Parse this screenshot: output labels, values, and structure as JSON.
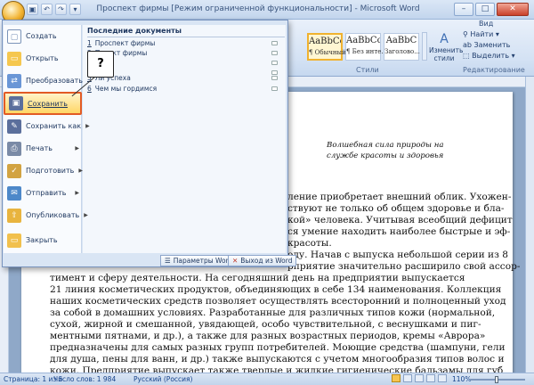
{
  "titlebar": {
    "title": "Проспект фирмы [Режим ограниченной функциональности] - Microsoft Word",
    "minimize": "–",
    "maximize": "□",
    "close": "✕"
  },
  "qat": [
    "save",
    "undo",
    "redo",
    "more"
  ],
  "ribbon": {
    "tabs": [
      "Вид"
    ],
    "styles": [
      {
        "preview": "AaBbCcI",
        "name": "¶ Обычный"
      },
      {
        "preview": "AaBbCcI",
        "name": "¶ Без инте..."
      },
      {
        "preview": "AaBbC",
        "name": "Заголово..."
      }
    ],
    "change_styles": "Изменить стили",
    "group_styles": "Стили",
    "group_editing": "Редактирование",
    "edit_find": "Найти",
    "edit_replace": "Заменить",
    "edit_select": "Выделить"
  },
  "office_menu": {
    "items": [
      {
        "label": "Создать",
        "icon": "new-document-icon",
        "submenu": false
      },
      {
        "label": "Открыть",
        "icon": "open-folder-icon",
        "submenu": false
      },
      {
        "label": "Преобразовать",
        "icon": "convert-icon",
        "submenu": false
      },
      {
        "label": "Сохранить",
        "icon": "save-icon",
        "submenu": false
      },
      {
        "label": "Сохранить как",
        "icon": "save-as-icon",
        "submenu": true
      },
      {
        "label": "Печать",
        "icon": "print-icon",
        "submenu": true
      },
      {
        "label": "Подготовить",
        "icon": "prepare-icon",
        "submenu": true
      },
      {
        "label": "Отправить",
        "icon": "send-icon",
        "submenu": true
      },
      {
        "label": "Опубликовать",
        "icon": "publish-icon",
        "submenu": true
      },
      {
        "label": "Закрыть",
        "icon": "close-document-icon",
        "submenu": false
      }
    ],
    "recent_header": "Последние документы",
    "recent": [
      {
        "num": "1",
        "name": "Проспект фирмы"
      },
      {
        "num": "2",
        "name": "Проект фирмы"
      },
      {
        "num": "3",
        "name": ""
      },
      {
        "num": "4",
        "name": ""
      },
      {
        "num": "5",
        "name": "Ли успеха"
      },
      {
        "num": "6",
        "name": "Чем мы гордимся"
      }
    ],
    "word_options": "Параметры Word",
    "exit_word": "Выход из Word",
    "callout": "?"
  },
  "document": {
    "heading_line1": "Волшебная сила природы на",
    "heading_line2": "службе красоты и здоровья",
    "lines": [
      "ление приобретает внешний облик. Ухожен-",
      "ствуют не только об общем здоровье и бла-",
      "кой» человека. Учитывая всеобщий дефицит",
      "ся умение находить наиболее быстрые и эф-",
      "красоты.",
      "оду. Начав с выпуска небольшой серии из 8",
      "рприятие значительно расширило свой ассор-",
      "тимент и сферу деятельности. На сегодняшний день на предприятии выпускается",
      "21 линия косметических продуктов, объединяющих в себе 134 наименования. Коллекция",
      "наших косметических средств позволяет осуществлять всесторонний и полноценный уход",
      "за собой в домашних условиях. Разработанные для различных типов кожи (нормальной,",
      "сухой, жирной и смешанной, увядающей, особо чувствительной, с веснушками и пиг-",
      "ментными пятнами, и др.), а также для разных возрастных периодов, кремы «Аврора»",
      "предназначены для самых разных групп потребителей. Моющие средства (шампуни, гели",
      "для душа, пены для ванн, и др.) также выпускаются с учетом многообразия типов волос и",
      "кожи. Предприятие выпускает также твердые и жидкие гигиенические бальзамы для губ,"
    ]
  },
  "statusbar": {
    "page": "Страница: 1 из 5",
    "words": "Число слов: 1 984",
    "language": "Русский (Россия)",
    "zoom": "110%"
  },
  "colors": {
    "highlight_border": "#e25b25",
    "accent": "#15428b"
  }
}
